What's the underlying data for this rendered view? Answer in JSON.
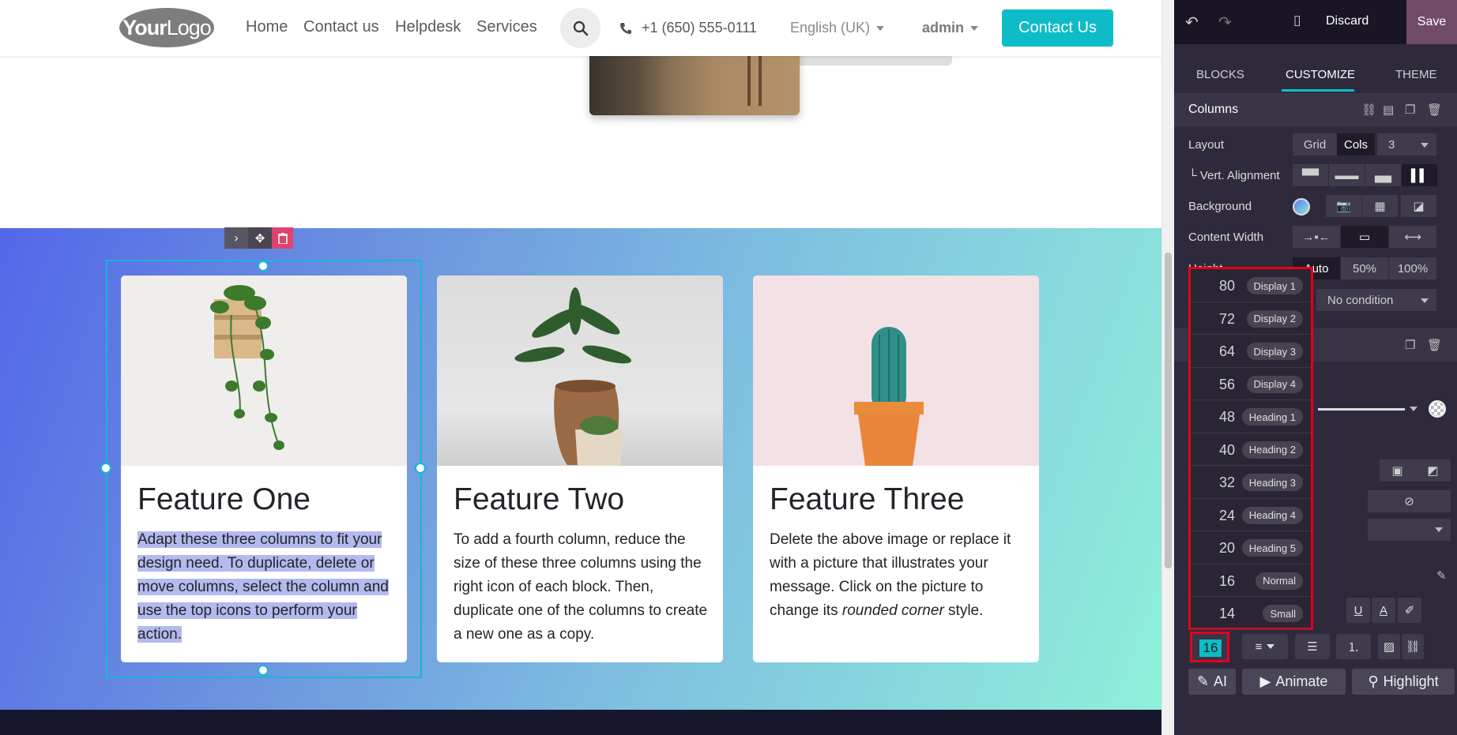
{
  "header": {
    "logo": {
      "bold": "Your",
      "rest": "Logo"
    },
    "nav": [
      "Home",
      "Contact us",
      "Helpdesk",
      "Services"
    ],
    "phone": "+1 (650) 555-0111",
    "language": "English (UK)",
    "user": "admin",
    "contact_button": "Contact Us"
  },
  "cards": [
    {
      "title": "Feature One",
      "text": "Adapt these three columns to fit your design need. To duplicate, delete or move columns, select the column and use the top icons to perform your action."
    },
    {
      "title": "Feature Two",
      "text": "To add a fourth column, reduce the size of these three columns using the right icon of each block. Then, duplicate one of the columns to create a new one as a copy."
    },
    {
      "title": "Feature Three",
      "text_before": "Delete the above image or replace it with a picture that illustrates your message. Click on the picture to change its ",
      "text_em": "rounded corner",
      "text_after": " style."
    }
  ],
  "editor": {
    "discard": "Discard",
    "save": "Save",
    "tabs": [
      "BLOCKS",
      "CUSTOMIZE",
      "THEME"
    ],
    "section_title": "Columns",
    "layout_label": "Layout",
    "layout_options": [
      "Grid",
      "Cols"
    ],
    "layout_count": "3",
    "vert_alignment_label": "└ Vert. Alignment",
    "background_label": "Background",
    "content_width_label": "Content Width",
    "height_label": "Height",
    "height_options": [
      "Auto",
      "50%",
      "100%"
    ],
    "visibility_value": "No condition",
    "font_sizes": [
      {
        "size": "80",
        "tag": "Display 1"
      },
      {
        "size": "72",
        "tag": "Display 2"
      },
      {
        "size": "64",
        "tag": "Display 3"
      },
      {
        "size": "56",
        "tag": "Display 4"
      },
      {
        "size": "48",
        "tag": "Heading 1"
      },
      {
        "size": "40",
        "tag": "Heading 2"
      },
      {
        "size": "32",
        "tag": "Heading 3"
      },
      {
        "size": "24",
        "tag": "Heading 4"
      },
      {
        "size": "20",
        "tag": "Heading 5"
      },
      {
        "size": "16",
        "tag": "Normal"
      },
      {
        "size": "14",
        "tag": "Small"
      }
    ],
    "current_font_size": "16",
    "ai_button": "AI",
    "animate_button": "Animate",
    "highlight_button": "Highlight"
  },
  "colors": {
    "accent": "#0ebcc8",
    "save_bg": "#714b67",
    "selection_outline": "#e5001a"
  }
}
